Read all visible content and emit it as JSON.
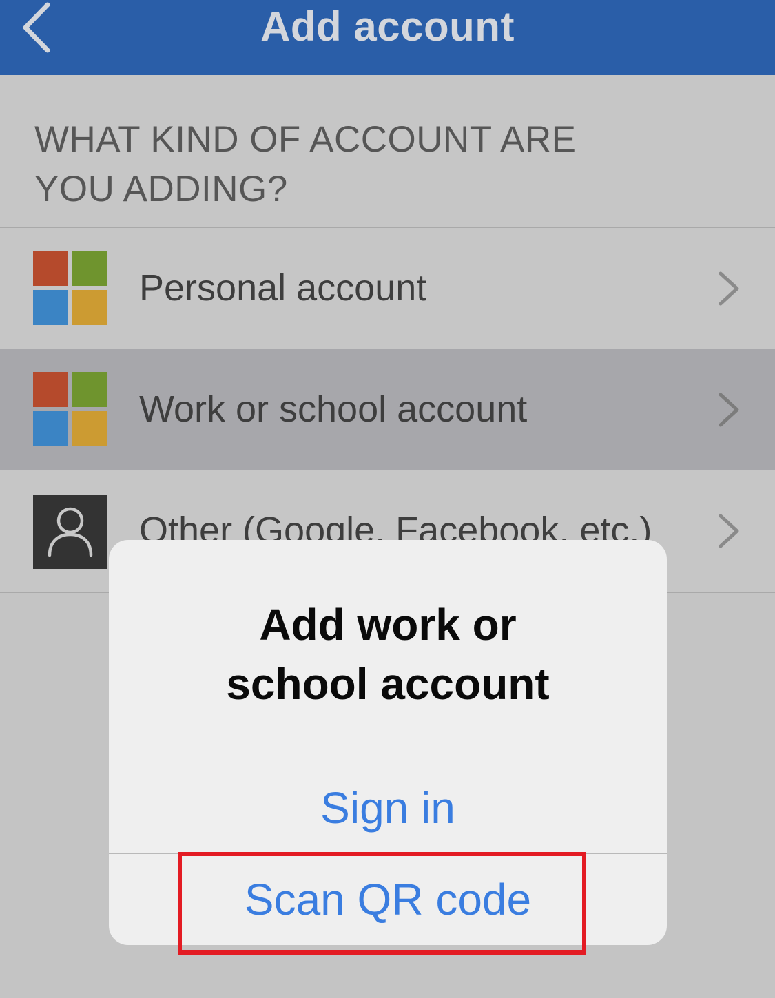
{
  "navbar": {
    "title": "Add account",
    "back_icon": "chevron-left-icon",
    "background": "#2a5ea8"
  },
  "section": {
    "header": "WHAT KIND OF ACCOUNT ARE YOU ADDING?"
  },
  "account_types": [
    {
      "label": "Personal account",
      "icon": "microsoft-logo-icon",
      "selected": false
    },
    {
      "label": "Work or school account",
      "icon": "microsoft-logo-icon",
      "selected": true
    },
    {
      "label": "Other (Google, Facebook, etc.)",
      "icon": "person-icon",
      "selected": false
    }
  ],
  "alert": {
    "title_line1": "Add work or",
    "title_line2": "school account",
    "signin_label": "Sign in",
    "scan_label": "Scan QR code",
    "action_color": "#3a7de0"
  },
  "highlight": {
    "color": "#e31b23",
    "target": "Scan QR code"
  }
}
